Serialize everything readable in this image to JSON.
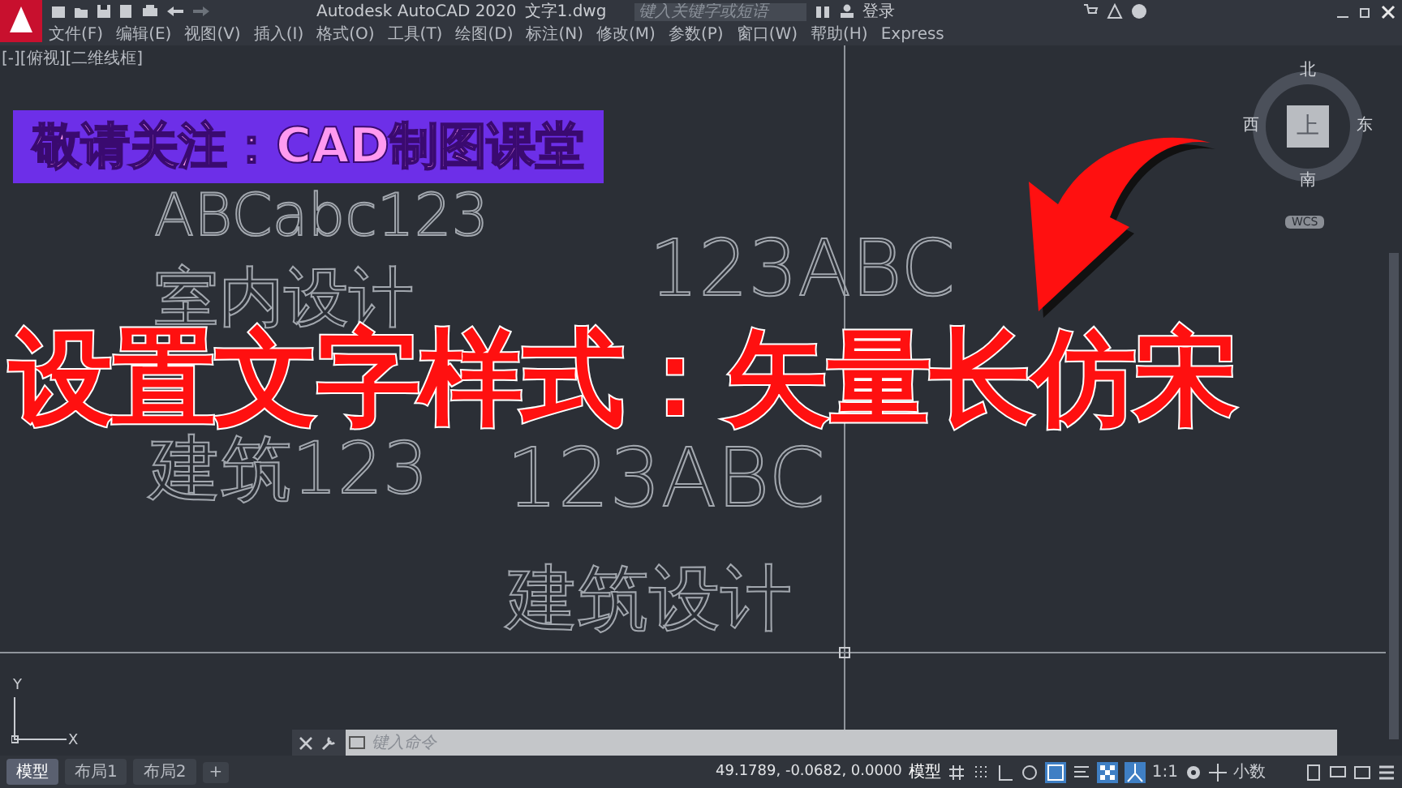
{
  "title_bar": {
    "title": "Autodesk AutoCAD 2020",
    "file": "文字1.dwg",
    "search": {
      "placeholder": "键入关键字或短语"
    },
    "sign_in": "登录"
  },
  "menu": [
    "文件(F)",
    "编辑(E)",
    "视图(V)",
    "插入(I)",
    "格式(O)",
    "工具(T)",
    "绘图(D)",
    "标注(N)",
    "修改(M)",
    "参数(P)",
    "窗口(W)",
    "帮助(H)",
    "Express"
  ],
  "viewport": {
    "label": "[-][俯视][二维线框]",
    "texts": [
      {
        "text": "ABCabc123"
      },
      {
        "text": "室内设计"
      },
      {
        "text": "123ABC"
      },
      {
        "text": "建筑123"
      },
      {
        "text": "123ABC"
      },
      {
        "text": "建筑设计"
      }
    ],
    "view_cube": {
      "north": "北",
      "west": "西",
      "top": "上",
      "east": "东",
      "south": "南",
      "ucs": "WCS"
    },
    "ucs_icon": {
      "y_axis": "Y",
      "x_axis": "X"
    }
  },
  "overlay": {
    "banner": "敬请关注：CAD制图课堂",
    "headline": "设置文字样式：矢量长仿宋"
  },
  "command_line": {
    "placeholder": "键入命令"
  },
  "layout_tabs": [
    {
      "label": "模型",
      "selected": true
    },
    {
      "label": "布局1",
      "selected": false
    },
    {
      "label": "布局2",
      "selected": false
    }
  ],
  "add_tab": "+",
  "status_bar": {
    "coordinates": "49.1789, -0.0682, 0.0000",
    "mode": "模型",
    "scale": "1:1",
    "units": "小数"
  }
}
